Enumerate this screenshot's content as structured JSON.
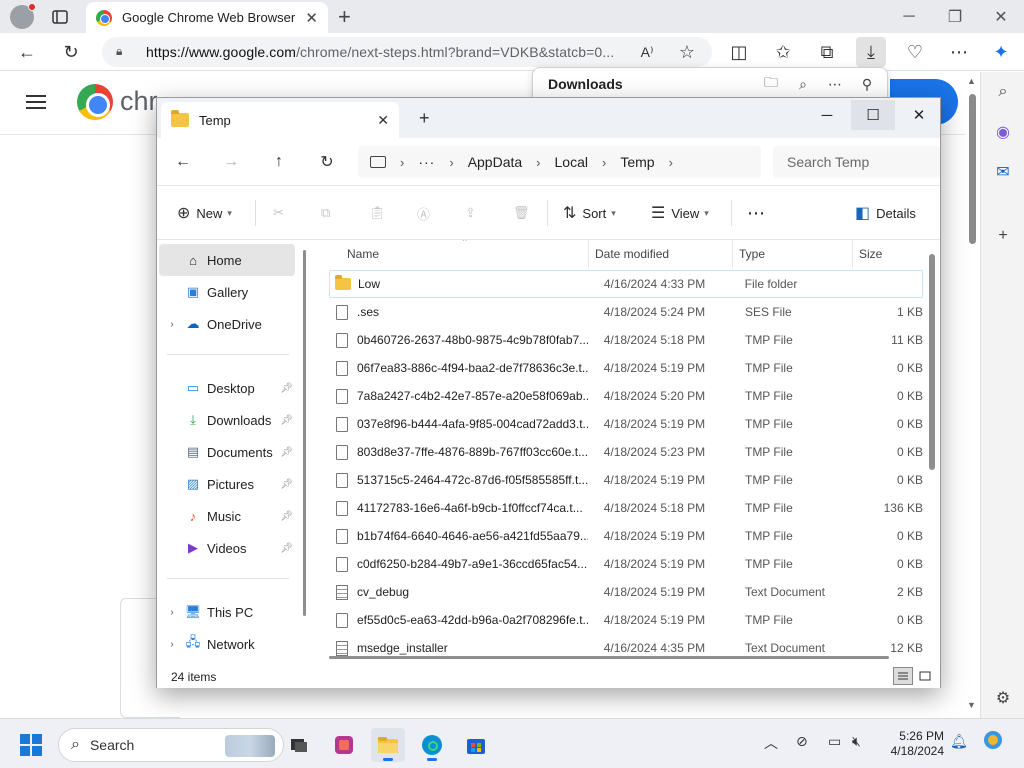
{
  "browser": {
    "tab_title": "Google Chrome Web Browser",
    "url_host": "https://www.google.com",
    "url_rest": "/chrome/next-steps.html?brand=VDKB&statcb=0..."
  },
  "page": {
    "brand_text": "chr"
  },
  "downloads": {
    "title": "Downloads"
  },
  "explorer": {
    "tab_title": "Temp",
    "breadcrumb": [
      "AppData",
      "Local",
      "Temp"
    ],
    "search_placeholder": "Search Temp",
    "commands": {
      "new": "New",
      "sort": "Sort",
      "view": "View",
      "details": "Details"
    },
    "nav": {
      "home": "Home",
      "gallery": "Gallery",
      "onedrive": "OneDrive",
      "desktop": "Desktop",
      "downloads": "Downloads",
      "documents": "Documents",
      "pictures": "Pictures",
      "music": "Music",
      "videos": "Videos",
      "thispc": "This PC",
      "network": "Network"
    },
    "columns": {
      "name": "Name",
      "date": "Date modified",
      "type": "Type",
      "size": "Size"
    },
    "files": [
      {
        "name": "Low",
        "date": "4/16/2024 4:33 PM",
        "type": "File folder",
        "size": "",
        "icon": "folder"
      },
      {
        "name": ".ses",
        "date": "4/18/2024 5:24 PM",
        "type": "SES File",
        "size": "1 KB",
        "icon": "file"
      },
      {
        "name": "0b460726-2637-48b0-9875-4c9b78f0fab7....",
        "date": "4/18/2024 5:18 PM",
        "type": "TMP File",
        "size": "11 KB",
        "icon": "file"
      },
      {
        "name": "06f7ea83-886c-4f94-baa2-de7f78636c3e.t...",
        "date": "4/18/2024 5:19 PM",
        "type": "TMP File",
        "size": "0 KB",
        "icon": "file"
      },
      {
        "name": "7a8a2427-c4b2-42e7-857e-a20e58f069ab....",
        "date": "4/18/2024 5:20 PM",
        "type": "TMP File",
        "size": "0 KB",
        "icon": "file"
      },
      {
        "name": "037e8f96-b444-4afa-9f85-004cad72add3.t...",
        "date": "4/18/2024 5:19 PM",
        "type": "TMP File",
        "size": "0 KB",
        "icon": "file"
      },
      {
        "name": "803d8e37-7ffe-4876-889b-767ff03cc60e.t...",
        "date": "4/18/2024 5:23 PM",
        "type": "TMP File",
        "size": "0 KB",
        "icon": "file"
      },
      {
        "name": "513715c5-2464-472c-87d6-f05f585585ff.t...",
        "date": "4/18/2024 5:19 PM",
        "type": "TMP File",
        "size": "0 KB",
        "icon": "file"
      },
      {
        "name": "41172783-16e6-4a6f-b9cb-1f0ffccf74ca.t...",
        "date": "4/18/2024 5:18 PM",
        "type": "TMP File",
        "size": "136 KB",
        "icon": "file"
      },
      {
        "name": "b1b74f64-6640-4646-ae56-a421fd55aa79....",
        "date": "4/18/2024 5:19 PM",
        "type": "TMP File",
        "size": "0 KB",
        "icon": "file"
      },
      {
        "name": "c0df6250-b284-49b7-a9e1-36ccd65fac54....",
        "date": "4/18/2024 5:19 PM",
        "type": "TMP File",
        "size": "0 KB",
        "icon": "file"
      },
      {
        "name": "cv_debug",
        "date": "4/18/2024 5:19 PM",
        "type": "Text Document",
        "size": "2 KB",
        "icon": "text"
      },
      {
        "name": "ef55d0c5-ea63-42dd-b96a-0a2f708296fe.t...",
        "date": "4/18/2024 5:19 PM",
        "type": "TMP File",
        "size": "0 KB",
        "icon": "file"
      },
      {
        "name": "msedge_installer",
        "date": "4/16/2024 4:35 PM",
        "type": "Text Document",
        "size": "12 KB",
        "icon": "text"
      }
    ],
    "status": "24 items"
  },
  "taskbar": {
    "search_label": "Search",
    "time": "5:26 PM",
    "date": "4/18/2024"
  },
  "colors": {
    "accent": "#1a73e8",
    "folder": "#f4c542",
    "windows_blue": "#1a78d6"
  }
}
